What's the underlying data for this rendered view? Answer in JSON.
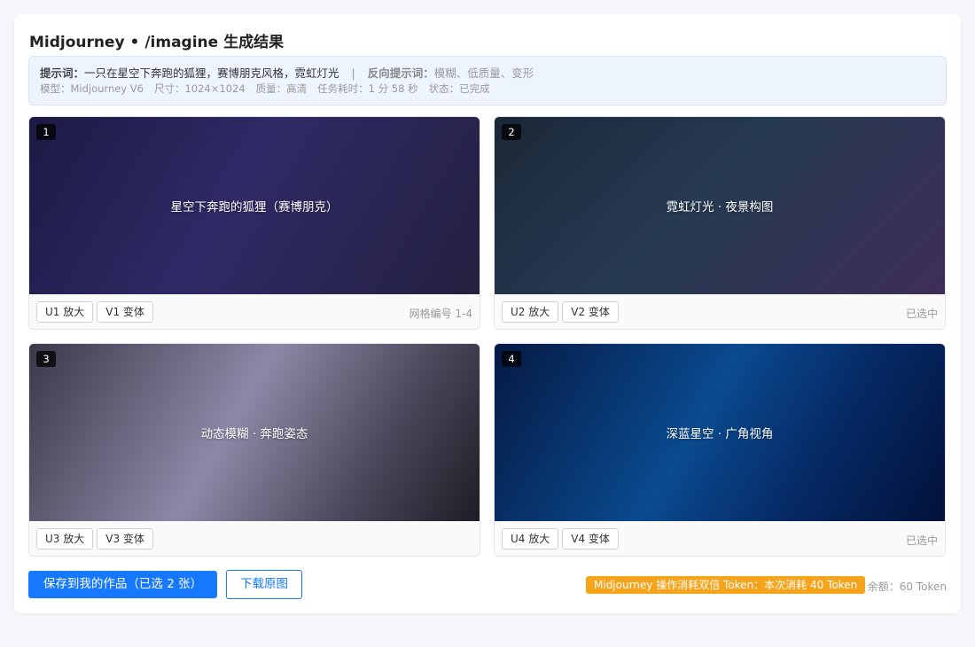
{
  "title": "Midjourney • /imagine 生成结果",
  "prompt": {
    "label": "提示词：",
    "text": "一只在星空下奔跑的狐狸，赛博朋克风格，霓虹灯光",
    "separator": "|",
    "negative_label": "反向提示词：",
    "negative_text": "模糊、低质量、变形"
  },
  "meta": {
    "model": "模型：Midjourney V6",
    "size": "尺寸：1024×1024",
    "quality": "质量：高清",
    "duration": "任务耗时：1 分 58 秒",
    "status": "状态：已完成"
  },
  "grid": [
    {
      "num": "1",
      "caption": "星空下奔跑的狐狸（赛博朋克）",
      "upscale": "U1 放大",
      "variant": "V1 变体",
      "right_text": "网格编号 1-4"
    },
    {
      "num": "2",
      "caption": "霓虹灯光 · 夜景构图",
      "upscale": "U2 放大",
      "variant": "V2 变体",
      "right_text": "已选中"
    },
    {
      "num": "3",
      "caption": "动态模糊 · 奔跑姿态",
      "upscale": "U3 放大",
      "variant": "V3 变体",
      "right_text": ""
    },
    {
      "num": "4",
      "caption": "深蓝星空 · 广角视角",
      "upscale": "U4 放大",
      "variant": "V4 变体",
      "right_text": "已选中"
    }
  ],
  "footer": {
    "save_label": "保存到我的作品（已选 2 张）",
    "download_label": "下载原图",
    "token_notice": "Midjourney 操作消耗双倍 Token：本次消耗 40 Token",
    "balance": "余额：60 Token"
  },
  "colors": {
    "primary": "#1677ff",
    "token_badge": "#f7a41d"
  }
}
